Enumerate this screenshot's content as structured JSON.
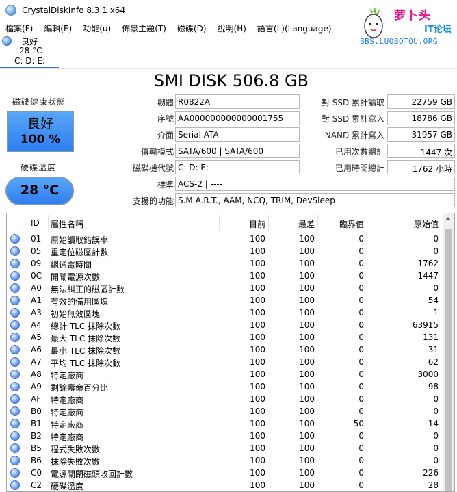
{
  "window": {
    "title": "CrystalDiskInfo 8.3.1 x64"
  },
  "watermark": {
    "name": "萝卜头",
    "sub": "IT论坛",
    "url": "BBS.LUOBOTOU.ORG"
  },
  "menu": [
    "檔案(F)",
    "編輯(E)",
    "功能(u)",
    "佈景主題(T)",
    "磁碟(D)",
    "說明(H)",
    "語言(L)(Language)"
  ],
  "drive_tab": {
    "status": "良好",
    "temp": "28 °C",
    "letters": "C: D: E:"
  },
  "disk": {
    "title": "SMI DISK 506.8 GB"
  },
  "health": {
    "label": "磁碟健康狀態",
    "status": "良好",
    "percent": "100 %",
    "color": "#3b8cf3"
  },
  "temperature": {
    "label": "硬碟溫度",
    "value": "28 °C"
  },
  "info": {
    "firmware": {
      "label": "韌體",
      "value": "R0822A"
    },
    "serial": {
      "label": "序號",
      "value": "AA000000000000001755"
    },
    "interface": {
      "label": "介面",
      "value": "Serial ATA"
    },
    "transfer": {
      "label": "傳輸模式",
      "value": "SATA/600 | SATA/600"
    },
    "drive_letter": {
      "label": "磁碟機代號",
      "value": "C: D: E:"
    },
    "standard": {
      "label": "標準",
      "value": "ACS-2 | ----"
    },
    "features": {
      "label": "支援的功能",
      "value": "S.M.A.R.T., AAM, NCQ, TRIM, DevSleep"
    },
    "host_reads": {
      "label": "對 SSD 累計讀取",
      "value": "22759 GB"
    },
    "host_writes": {
      "label": "對 SSD 累計寫入",
      "value": "18786 GB"
    },
    "nand_writes": {
      "label": "NAND 累計寫入",
      "value": "31957 GB"
    },
    "power_count": {
      "label": "已用次數總計",
      "value": "1447 次"
    },
    "power_hours": {
      "label": "已用時間總計",
      "value": "1762 小時"
    }
  },
  "table": {
    "headers": {
      "id": "ID",
      "name": "屬性名稱",
      "current": "目前",
      "worst": "最差",
      "threshold": "臨界值",
      "raw": "原始值"
    },
    "rows": [
      {
        "id": "01",
        "name": "原始讀取錯誤率",
        "current": "100",
        "worst": "100",
        "threshold": "0",
        "raw": "0"
      },
      {
        "id": "05",
        "name": "重定位磁區計數",
        "current": "100",
        "worst": "100",
        "threshold": "0",
        "raw": "0"
      },
      {
        "id": "09",
        "name": "總通電時間",
        "current": "100",
        "worst": "100",
        "threshold": "0",
        "raw": "1762"
      },
      {
        "id": "0C",
        "name": "開關電源次數",
        "current": "100",
        "worst": "100",
        "threshold": "0",
        "raw": "1447"
      },
      {
        "id": "A0",
        "name": "無法糾正的磁區計數",
        "current": "100",
        "worst": "100",
        "threshold": "0",
        "raw": "0"
      },
      {
        "id": "A1",
        "name": "有效的備用區塊",
        "current": "100",
        "worst": "100",
        "threshold": "0",
        "raw": "54"
      },
      {
        "id": "A3",
        "name": "初始無效區塊",
        "current": "100",
        "worst": "100",
        "threshold": "0",
        "raw": "1"
      },
      {
        "id": "A4",
        "name": "總計 TLC 抹除次數",
        "current": "100",
        "worst": "100",
        "threshold": "0",
        "raw": "63915"
      },
      {
        "id": "A5",
        "name": "最大 TLC 抹除次數",
        "current": "100",
        "worst": "100",
        "threshold": "0",
        "raw": "131"
      },
      {
        "id": "A6",
        "name": "最小 TLC 抹除次數",
        "current": "100",
        "worst": "100",
        "threshold": "0",
        "raw": "31"
      },
      {
        "id": "A7",
        "name": "平均 TLC 抹除次數",
        "current": "100",
        "worst": "100",
        "threshold": "0",
        "raw": "62"
      },
      {
        "id": "A8",
        "name": "特定廠商",
        "current": "100",
        "worst": "100",
        "threshold": "0",
        "raw": "3000"
      },
      {
        "id": "A9",
        "name": "剩餘壽命百分比",
        "current": "100",
        "worst": "100",
        "threshold": "0",
        "raw": "98"
      },
      {
        "id": "AF",
        "name": "特定廠商",
        "current": "100",
        "worst": "100",
        "threshold": "0",
        "raw": "0"
      },
      {
        "id": "B0",
        "name": "特定廠商",
        "current": "100",
        "worst": "100",
        "threshold": "0",
        "raw": "0"
      },
      {
        "id": "B1",
        "name": "特定廠商",
        "current": "100",
        "worst": "100",
        "threshold": "50",
        "raw": "14"
      },
      {
        "id": "B2",
        "name": "特定廠商",
        "current": "100",
        "worst": "100",
        "threshold": "0",
        "raw": "0"
      },
      {
        "id": "B5",
        "name": "程式失敗次數",
        "current": "100",
        "worst": "100",
        "threshold": "0",
        "raw": "0"
      },
      {
        "id": "B6",
        "name": "抹除失敗次數",
        "current": "100",
        "worst": "100",
        "threshold": "0",
        "raw": "0"
      },
      {
        "id": "C0",
        "name": "電源關閉磁頭收回計數",
        "current": "100",
        "worst": "100",
        "threshold": "0",
        "raw": "226"
      },
      {
        "id": "C2",
        "name": "硬碟溫度",
        "current": "100",
        "worst": "100",
        "threshold": "0",
        "raw": "28"
      }
    ]
  }
}
